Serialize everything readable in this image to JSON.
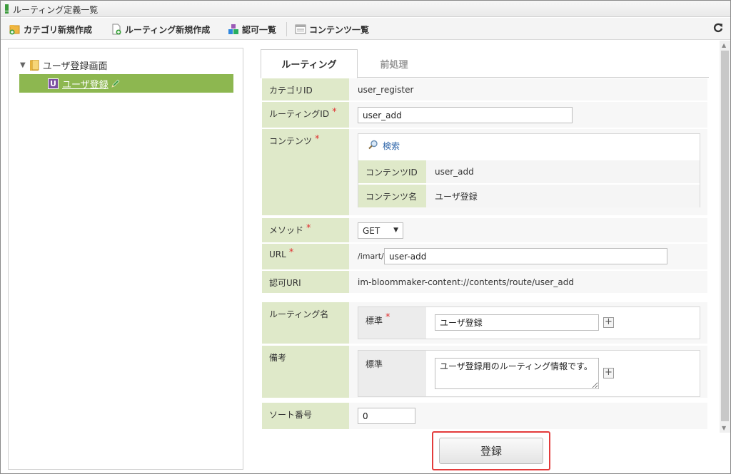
{
  "window": {
    "title": "ルーティング定義一覧"
  },
  "toolbar": {
    "new_category": "カテゴリ新規作成",
    "new_routing": "ルーティング新規作成",
    "auth_list": "認可一覧",
    "content_list": "コンテンツ一覧"
  },
  "tree": {
    "root_label": "ユーザ登録画面",
    "selected_badge": "U",
    "selected_label": "ユーザ登録"
  },
  "tabs": {
    "routing": "ルーティング",
    "preprocess": "前処理"
  },
  "form": {
    "category_id": {
      "label": "カテゴリID",
      "value": "user_register"
    },
    "routing_id": {
      "label": "ルーティングID",
      "required": "*",
      "value": "user_add"
    },
    "content": {
      "label": "コンテンツ",
      "required": "*",
      "search": "検索",
      "content_id_label": "コンテンツID",
      "content_id_value": "user_add",
      "content_name_label": "コンテンツ名",
      "content_name_value": "ユーザ登録"
    },
    "method": {
      "label": "メソッド",
      "required": "*",
      "value": "GET"
    },
    "url": {
      "label": "URL",
      "required": "*",
      "prefix": "/imart/",
      "value": "user-add"
    },
    "auth_uri": {
      "label": "認可URI",
      "value": "im-bloommaker-content://contents/route/user_add"
    },
    "routing_name": {
      "label": "ルーティング名",
      "locale_label": "標準",
      "required": "*",
      "value": "ユーザ登録"
    },
    "remarks": {
      "label": "備考",
      "locale_label": "標準",
      "value": "ユーザ登録用のルーティング情報です。"
    },
    "sort_no": {
      "label": "ソート番号",
      "value": "0"
    }
  },
  "actions": {
    "submit": "登録"
  },
  "colors": {
    "label_bg": "#dfe9c9",
    "tree_selected": "#8db750",
    "required": "#e03030",
    "highlight": "#e33b3b"
  }
}
